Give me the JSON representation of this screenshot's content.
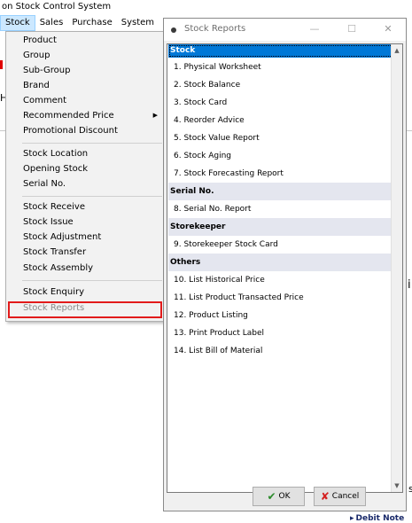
{
  "app": {
    "title": "on Stock Control System"
  },
  "menubar": {
    "items": [
      "Stock",
      "Sales",
      "Purchase",
      "System"
    ]
  },
  "dropdown": {
    "items": [
      {
        "label": "Product"
      },
      {
        "label": "Group"
      },
      {
        "label": "Sub-Group"
      },
      {
        "label": "Brand"
      },
      {
        "label": "Comment"
      },
      {
        "label": "Recommended Price",
        "submenu": true
      },
      {
        "label": "Promotional Discount"
      },
      {
        "label": "Stock Location"
      },
      {
        "label": "Opening Stock"
      },
      {
        "label": "Serial No."
      },
      {
        "label": "Stock Receive"
      },
      {
        "label": "Stock Issue"
      },
      {
        "label": "Stock Adjustment"
      },
      {
        "label": "Stock Transfer"
      },
      {
        "label": "Stock Assembly"
      },
      {
        "label": "Stock Enquiry"
      },
      {
        "label": "Stock Reports",
        "disabled": true,
        "highlighted": true
      }
    ]
  },
  "dialog": {
    "title": "Stock Reports",
    "controls": {
      "minimize": "—",
      "maximize": "☐",
      "close": "✕"
    },
    "list": [
      {
        "type": "header",
        "label": "Stock",
        "selected": true
      },
      {
        "type": "item",
        "label": "1. Physical Worksheet"
      },
      {
        "type": "item",
        "label": "2. Stock Balance"
      },
      {
        "type": "item",
        "label": "3. Stock Card"
      },
      {
        "type": "item",
        "label": "4. Reorder Advice"
      },
      {
        "type": "item",
        "label": "5. Stock Value Report"
      },
      {
        "type": "item",
        "label": "6. Stock Aging"
      },
      {
        "type": "item",
        "label": "7. Stock Forecasting Report"
      },
      {
        "type": "header",
        "label": "Serial No."
      },
      {
        "type": "item",
        "label": "8. Serial No. Report"
      },
      {
        "type": "header",
        "label": "Storekeeper"
      },
      {
        "type": "item",
        "label": "9. Storekeeper Stock Card"
      },
      {
        "type": "header",
        "label": "Others"
      },
      {
        "type": "item",
        "label": "10. List Historical Price"
      },
      {
        "type": "item",
        "label": "11. List Product Transacted Price"
      },
      {
        "type": "item",
        "label": "12. Product Listing"
      },
      {
        "type": "item",
        "label": "13. Print Product Label"
      },
      {
        "type": "item",
        "label": "14. List Bill of Material"
      }
    ],
    "ok_label": "OK",
    "cancel_label": "Cancel"
  },
  "background": {
    "frag_h": "H",
    "frag_i": "i",
    "frag_s": "s",
    "debit_note": "Debit Note"
  },
  "colors": {
    "selection": "#0078d7",
    "header_bg": "#e4e6ef",
    "highlight_box": "#e21b1b",
    "menu_active": "#cce8ff"
  },
  "icons": {
    "ok": "check-icon",
    "cancel": "x-icon",
    "submenu": "chevron-right-icon",
    "scroll_up": "chevron-up-icon",
    "scroll_down": "chevron-down-icon"
  }
}
